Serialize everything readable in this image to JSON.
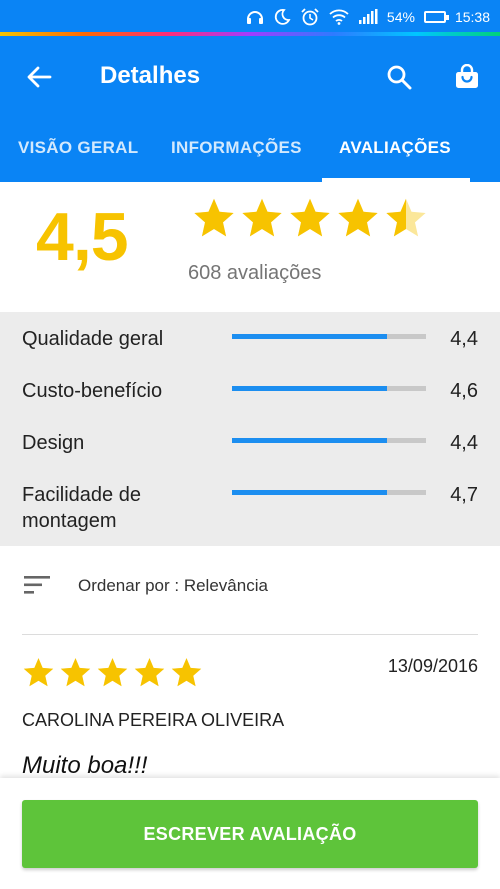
{
  "status_bar": {
    "battery": "54%",
    "time": "15:38",
    "icons": [
      "headphones-icon",
      "moon-icon",
      "alarm-icon",
      "wifi-icon",
      "signal-icon",
      "battery-icon"
    ]
  },
  "app_bar": {
    "title": "Detalhes",
    "icons": [
      "back-arrow-icon",
      "search-icon",
      "shopping-bag-icon"
    ]
  },
  "tabs": [
    {
      "label": "VISÃO GERAL",
      "active": false
    },
    {
      "label": "INFORMAÇÕES",
      "active": false
    },
    {
      "label": "AVALIAÇÕES",
      "active": true
    }
  ],
  "summary": {
    "score": "4,5",
    "stars": 4.5,
    "count_text": "608 avaliações"
  },
  "ratings": [
    {
      "label": "Qualidade geral",
      "value": "4,4",
      "fill_fraction": 0.8
    },
    {
      "label": "Custo-benefício",
      "value": "4,6",
      "fill_fraction": 0.8
    },
    {
      "label": "Design",
      "value": "4,4",
      "fill_fraction": 0.8
    },
    {
      "label": "Facilidade de montagem",
      "value": "4,7",
      "fill_fraction": 0.8
    }
  ],
  "sort": {
    "label": "Ordenar por : Relevância"
  },
  "review": {
    "stars": 5,
    "date": "13/09/2016",
    "author": "CAROLINA PEREIRA OLIVEIRA",
    "title": "Muito boa!!!"
  },
  "cta": {
    "label": "ESCREVER AVALIAÇÃO"
  },
  "colors": {
    "primary": "#0a84f5",
    "star": "#f7c300",
    "bar_fill": "#1c8ef0",
    "cta": "#5ec43a"
  }
}
